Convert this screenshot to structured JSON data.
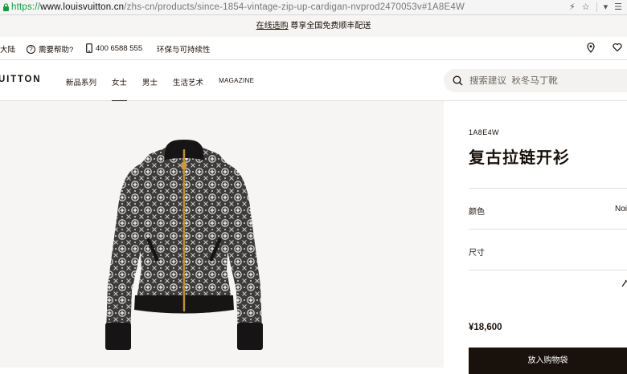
{
  "browser": {
    "url_scheme": "https://",
    "url_host": "www.louisvuitton.cn",
    "url_path": "/zhs-cn/products/since-1854-vintage-zip-up-cardigan-nvprod2470053v#1A8E4W"
  },
  "promo": {
    "link_text": "在线选购",
    "text": " 尊享全国免费顺丰配送"
  },
  "utility": {
    "region": "大陆",
    "help": "需要帮助?",
    "phone": "400 6588 555",
    "sustainability": "环保与可持续性"
  },
  "nav": {
    "logo": "UITTON",
    "links": [
      "新品系列",
      "女士",
      "男士",
      "生活艺术",
      "MAGAZINE"
    ],
    "search_placeholder": "搜索建议  秋冬马丁靴"
  },
  "product": {
    "sku": "1A8E4W",
    "title": "复古拉链开衫",
    "color_label": "颜色",
    "color_value": "Noi",
    "size_label": "尺寸",
    "price": "¥18,600",
    "add_to_cart": "放入购物袋"
  },
  "colors": {
    "brand_dark": "#19110b",
    "image_bg": "#f6f5f3",
    "url_green": "#129d3c"
  }
}
